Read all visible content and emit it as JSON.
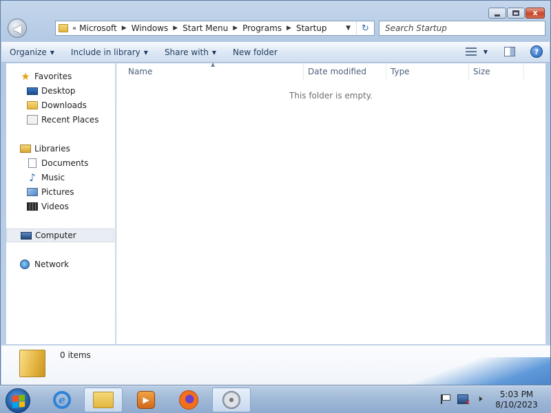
{
  "window": {
    "address": {
      "overflow_chevron": "«",
      "crumbs": [
        "Microsoft",
        "Windows",
        "Start Menu",
        "Programs",
        "Startup"
      ]
    },
    "search": {
      "placeholder": "Search Startup"
    },
    "caption": {
      "minimize": "",
      "maximize": "",
      "close": "x"
    }
  },
  "commandbar": {
    "organize": "Organize",
    "include_in_library": "Include in library",
    "share_with": "Share with",
    "new_folder": "New folder",
    "help": "?"
  },
  "navpane": {
    "favorites": {
      "label": "Favorites",
      "items": [
        "Desktop",
        "Downloads",
        "Recent Places"
      ]
    },
    "libraries": {
      "label": "Libraries",
      "items": [
        "Documents",
        "Music",
        "Pictures",
        "Videos"
      ]
    },
    "computer": "Computer",
    "network": "Network"
  },
  "filelist": {
    "columns": [
      "Name",
      "Date modified",
      "Type",
      "Size"
    ],
    "empty_message": "This folder is empty."
  },
  "details": {
    "item_count": "0 items"
  },
  "taskbar": {
    "clock_time": "5:03 PM",
    "clock_date": "8/10/2023"
  },
  "icons": {
    "back": "back-arrow-icon",
    "favorites": "star-icon",
    "libraries": "library-icon",
    "computer": "computer-icon",
    "network": "network-icon"
  },
  "colors": {
    "frame": "#b3c9e4",
    "accent": "#1e395b",
    "taskbar": "#9fb8d6"
  }
}
